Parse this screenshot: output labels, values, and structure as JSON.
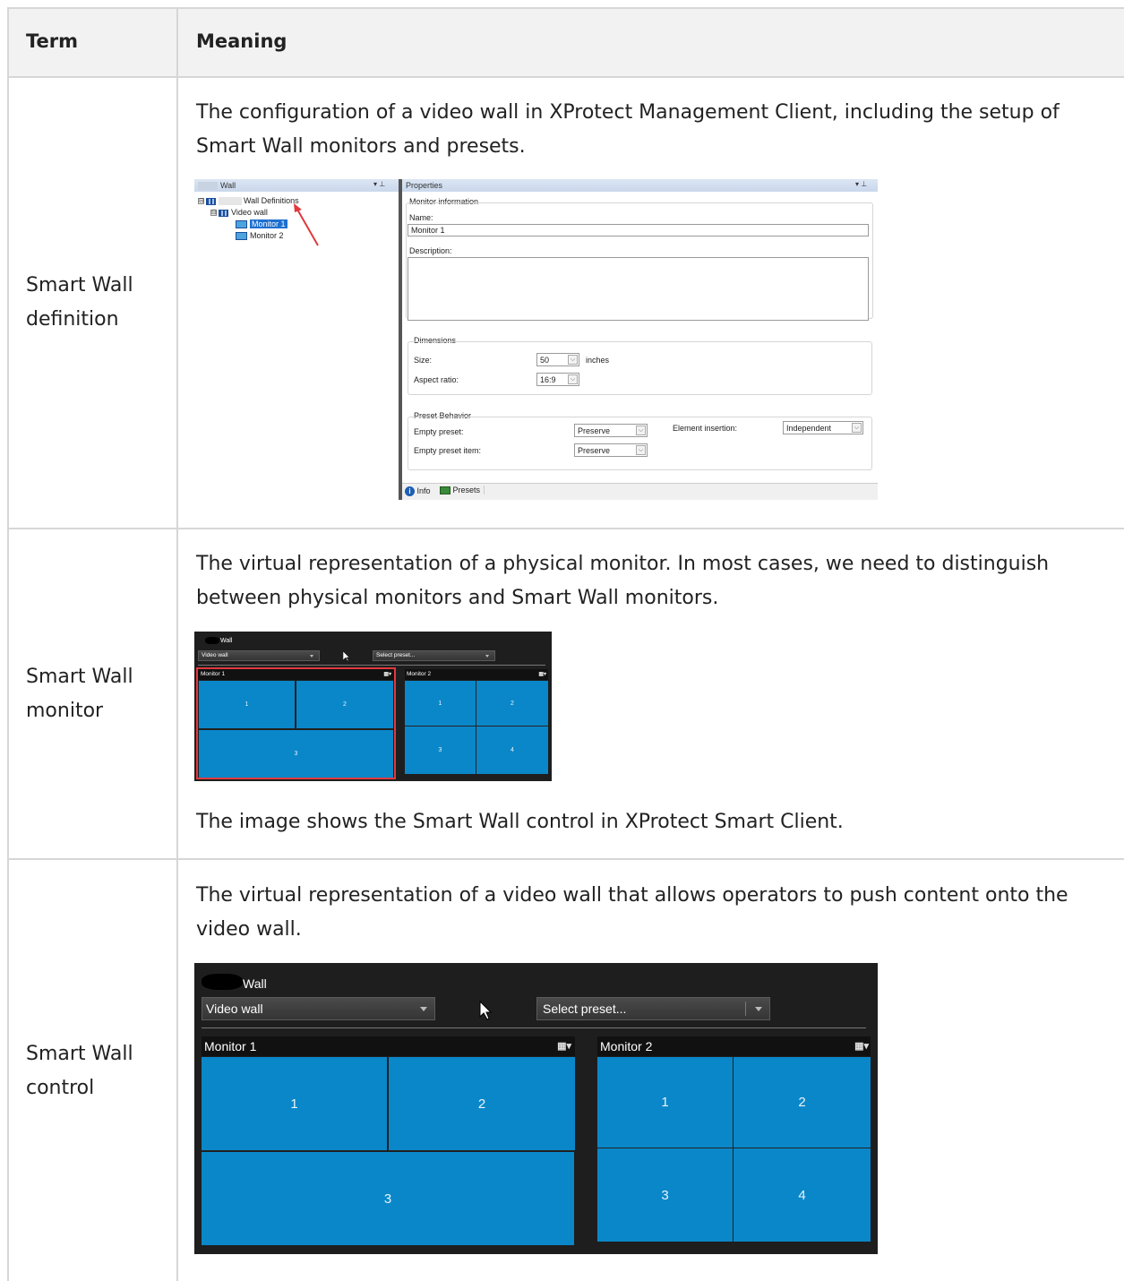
{
  "table": {
    "headers": {
      "term": "Term",
      "meaning": "Meaning"
    },
    "rows": [
      {
        "term": "Smart Wall definition",
        "meaning": "The configuration of a video wall in XProtect Management Client, including the setup of Smart Wall monitors and presets."
      },
      {
        "term": "Smart Wall monitor",
        "meaning": "The virtual representation of a physical monitor. In most cases, we need to distinguish between physical monitors and Smart Wall monitors.",
        "caption": "The image shows the Smart Wall control in XProtect Smart Client."
      },
      {
        "term": "Smart Wall control",
        "meaning": "The virtual representation of a video wall that allows operators to push content onto the video wall."
      }
    ]
  },
  "management_client": {
    "left_pane_title": "Wall",
    "tree": {
      "root": "Wall Definitions",
      "wall": "Video wall",
      "monitors": [
        "Monitor 1",
        "Monitor 2"
      ]
    },
    "right_pane_title": "Properties",
    "monitor_info_label": "Monitor information",
    "name_label": "Name:",
    "name_value": "Monitor 1",
    "description_label": "Description:",
    "dimensions_label": "Dimensions",
    "size_label": "Size:",
    "size_value": "50",
    "size_unit": "inches",
    "aspect_label": "Aspect ratio:",
    "aspect_value": "16:9",
    "preset_behavior_label": "Preset Behavior",
    "empty_preset_label": "Empty preset:",
    "empty_preset_value": "Preserve",
    "empty_preset_item_label": "Empty preset item:",
    "empty_preset_item_value": "Preserve",
    "element_insertion_label": "Element insertion:",
    "element_insertion_value": "Independent",
    "tab_info": "Info",
    "tab_presets": "Presets",
    "pin_glyph": "▾ ⊥",
    "expander_glyph": "⊟",
    "dropdown_glyph": "⌵"
  },
  "smart_wall_small": {
    "title": "Wall",
    "wall_select": "Video wall",
    "preset_select": "Select preset...",
    "monitors": [
      {
        "name": "Monitor 1",
        "tiles": [
          "1",
          "2",
          "3"
        ]
      },
      {
        "name": "Monitor 2",
        "tiles": [
          "1",
          "2",
          "3",
          "4"
        ]
      }
    ],
    "layout_glyph": "▦▾"
  },
  "smart_wall_large": {
    "title": "Wall",
    "wall_select": "Video wall",
    "preset_select": "Select preset...",
    "monitors": [
      {
        "name": "Monitor 1",
        "tiles": [
          "1",
          "2",
          "3"
        ]
      },
      {
        "name": "Monitor 2",
        "tiles": [
          "1",
          "2",
          "3",
          "4"
        ]
      }
    ],
    "layout_glyph": "▦▾"
  },
  "colors": {
    "tile_blue": "#0a87c9",
    "selected_red": "#e0393e",
    "header_bg": "#f2f2f2",
    "border": "#d6d6d6",
    "arrow_red": "#e0393e"
  }
}
